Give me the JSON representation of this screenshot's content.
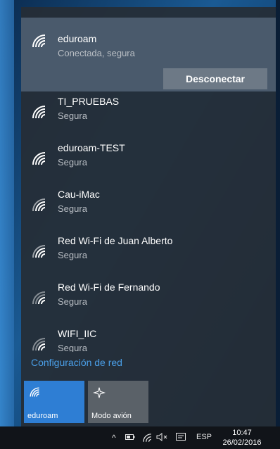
{
  "connected_network": {
    "name": "eduroam",
    "status": "Conectada, segura",
    "disconnect_label": "Desconectar"
  },
  "networks": [
    {
      "name": "TI_PRUEBAS",
      "status": "Segura"
    },
    {
      "name": "eduroam-TEST",
      "status": "Segura"
    },
    {
      "name": "Cau-iMac",
      "status": "Segura"
    },
    {
      "name": "Red Wi-Fi de Juan Alberto",
      "status": "Segura"
    },
    {
      "name": "Red Wi-Fi de Fernando",
      "status": "Segura"
    },
    {
      "name": "WIFI_IIC",
      "status": "Segura"
    }
  ],
  "settings_link": "Configuración de red",
  "quick_actions": [
    {
      "label": "eduroam",
      "icon": "wifi-icon",
      "active": true
    },
    {
      "label": "Modo avión",
      "icon": "airplane-icon",
      "active": false
    }
  ],
  "taskbar": {
    "language": "ESP",
    "time": "10:47",
    "date": "26/02/2016"
  },
  "colors": {
    "accent": "#2e7ed4",
    "link": "#4a9fe8",
    "panel": "#262d36",
    "connected_bg": "#4a5a6c"
  }
}
